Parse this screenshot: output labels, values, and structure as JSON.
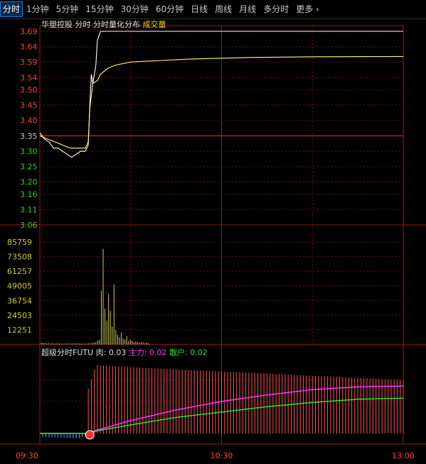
{
  "tabs": {
    "items": [
      "分时",
      "1分钟",
      "5分钟",
      "15分钟",
      "30分钟",
      "60分钟",
      "日线",
      "周线",
      "月线",
      "多分时",
      "更多"
    ],
    "active_index": 0,
    "more_icon": "chevron-right-icon"
  },
  "price_panel": {
    "stock_name": "华塑控股",
    "view_label": "分时",
    "dist_label": "分时量化分布",
    "volume_label": "成交量",
    "prev_close": 3.35,
    "y_range": [
      3.06,
      3.69
    ],
    "y_ticks": [
      "3.69",
      "3.64",
      "3.59",
      "3.54",
      "3.50",
      "3.45",
      "3.40",
      "3.35",
      "3.30",
      "3.25",
      "3.20",
      "3.16",
      "3.11",
      "3.06"
    ],
    "line_color": "#ffffff",
    "avg_color": "#ffff66"
  },
  "volume_panel": {
    "y_ticks": [
      "85759",
      "73508",
      "61257",
      "49005",
      "36754",
      "24503",
      "12251"
    ],
    "y_max": 85759,
    "bar_color": "#cccc55"
  },
  "futu_panel": {
    "title": "超级分时FUTU",
    "rou_label": "肉: 0.03",
    "zhuli_label": "主力: 0.02",
    "sanhu_label": "散户: 0.02",
    "zhuli_color": "#ff33ff",
    "sanhu_color": "#33dd33",
    "bar_color": "#ff5555",
    "marker_icon": "signal-ball-icon"
  },
  "time_axis": {
    "labels": [
      "09:30",
      "10:30",
      "13:00"
    ]
  },
  "chart_data": [
    {
      "type": "line",
      "title": "华塑控股 分时",
      "x_range": [
        0,
        240
      ],
      "ylim": [
        3.06,
        3.69
      ],
      "series": [
        {
          "name": "分时",
          "points": [
            [
              0,
              3.36
            ],
            [
              3,
              3.34
            ],
            [
              6,
              3.33
            ],
            [
              9,
              3.31
            ],
            [
              12,
              3.31
            ],
            [
              15,
              3.3
            ],
            [
              18,
              3.29
            ],
            [
              21,
              3.28
            ],
            [
              24,
              3.29
            ],
            [
              27,
              3.3
            ],
            [
              30,
              3.3
            ],
            [
              32,
              3.32
            ],
            [
              33,
              3.45
            ],
            [
              34,
              3.55
            ],
            [
              35,
              3.52
            ],
            [
              37,
              3.58
            ],
            [
              38,
              3.66
            ],
            [
              40,
              3.69
            ],
            [
              60,
              3.69
            ],
            [
              120,
              3.69
            ],
            [
              180,
              3.69
            ],
            [
              240,
              3.69
            ]
          ]
        },
        {
          "name": "均价",
          "points": [
            [
              0,
              3.35
            ],
            [
              5,
              3.34
            ],
            [
              10,
              3.33
            ],
            [
              15,
              3.32
            ],
            [
              20,
              3.31
            ],
            [
              25,
              3.31
            ],
            [
              30,
              3.31
            ],
            [
              32,
              3.33
            ],
            [
              33,
              3.44
            ],
            [
              35,
              3.52
            ],
            [
              38,
              3.53
            ],
            [
              40,
              3.55
            ],
            [
              45,
              3.57
            ],
            [
              50,
              3.58
            ],
            [
              60,
              3.59
            ],
            [
              80,
              3.595
            ],
            [
              100,
              3.6
            ],
            [
              140,
              3.605
            ],
            [
              180,
              3.607
            ],
            [
              240,
              3.608
            ]
          ]
        }
      ]
    },
    {
      "type": "bar",
      "title": "成交量",
      "x_range": [
        0,
        240
      ],
      "ylim": [
        0,
        85759
      ],
      "values": [
        1500,
        1200,
        1100,
        900,
        1000,
        800,
        900,
        700,
        800,
        900,
        700,
        800,
        600,
        700,
        900,
        700,
        600,
        800,
        700,
        900,
        1000,
        800,
        700,
        600,
        800,
        700,
        900,
        1000,
        1200,
        1500,
        2000,
        3000,
        4000,
        45000,
        80000,
        30000,
        20000,
        42000,
        28000,
        15000,
        50000,
        12000,
        8000,
        6000,
        10000,
        5000,
        4000,
        7000,
        3000,
        4000,
        3000,
        2000,
        2500,
        2000,
        1500,
        2000,
        1800,
        1200,
        1500,
        1000
      ]
    },
    {
      "type": "line",
      "title": "超级分时FUTU",
      "x_range": [
        0,
        240
      ],
      "ylim": [
        -0.005,
        0.035
      ],
      "series": [
        {
          "name": "主力",
          "points": [
            [
              0,
              0
            ],
            [
              30,
              0
            ],
            [
              40,
              0.002
            ],
            [
              60,
              0.006
            ],
            [
              90,
              0.011
            ],
            [
              120,
              0.015
            ],
            [
              150,
              0.018
            ],
            [
              180,
              0.0205
            ],
            [
              210,
              0.0218
            ],
            [
              240,
              0.0222
            ]
          ]
        },
        {
          "name": "散户",
          "points": [
            [
              0,
              0
            ],
            [
              30,
              0
            ],
            [
              40,
              0.0015
            ],
            [
              60,
              0.004
            ],
            [
              90,
              0.0075
            ],
            [
              120,
              0.01
            ],
            [
              150,
              0.0125
            ],
            [
              180,
              0.0145
            ],
            [
              210,
              0.016
            ],
            [
              240,
              0.0165
            ]
          ]
        },
        {
          "name": "肉",
          "points": [
            [
              0,
              -0.0015
            ],
            [
              15,
              -0.002
            ],
            [
              25,
              -0.0025
            ],
            [
              30,
              -0.001
            ],
            [
              32,
              0.021
            ],
            [
              37,
              0.032
            ],
            [
              60,
              0.031
            ],
            [
              120,
              0.029
            ],
            [
              180,
              0.027
            ],
            [
              240,
              0.025
            ]
          ]
        }
      ]
    }
  ]
}
